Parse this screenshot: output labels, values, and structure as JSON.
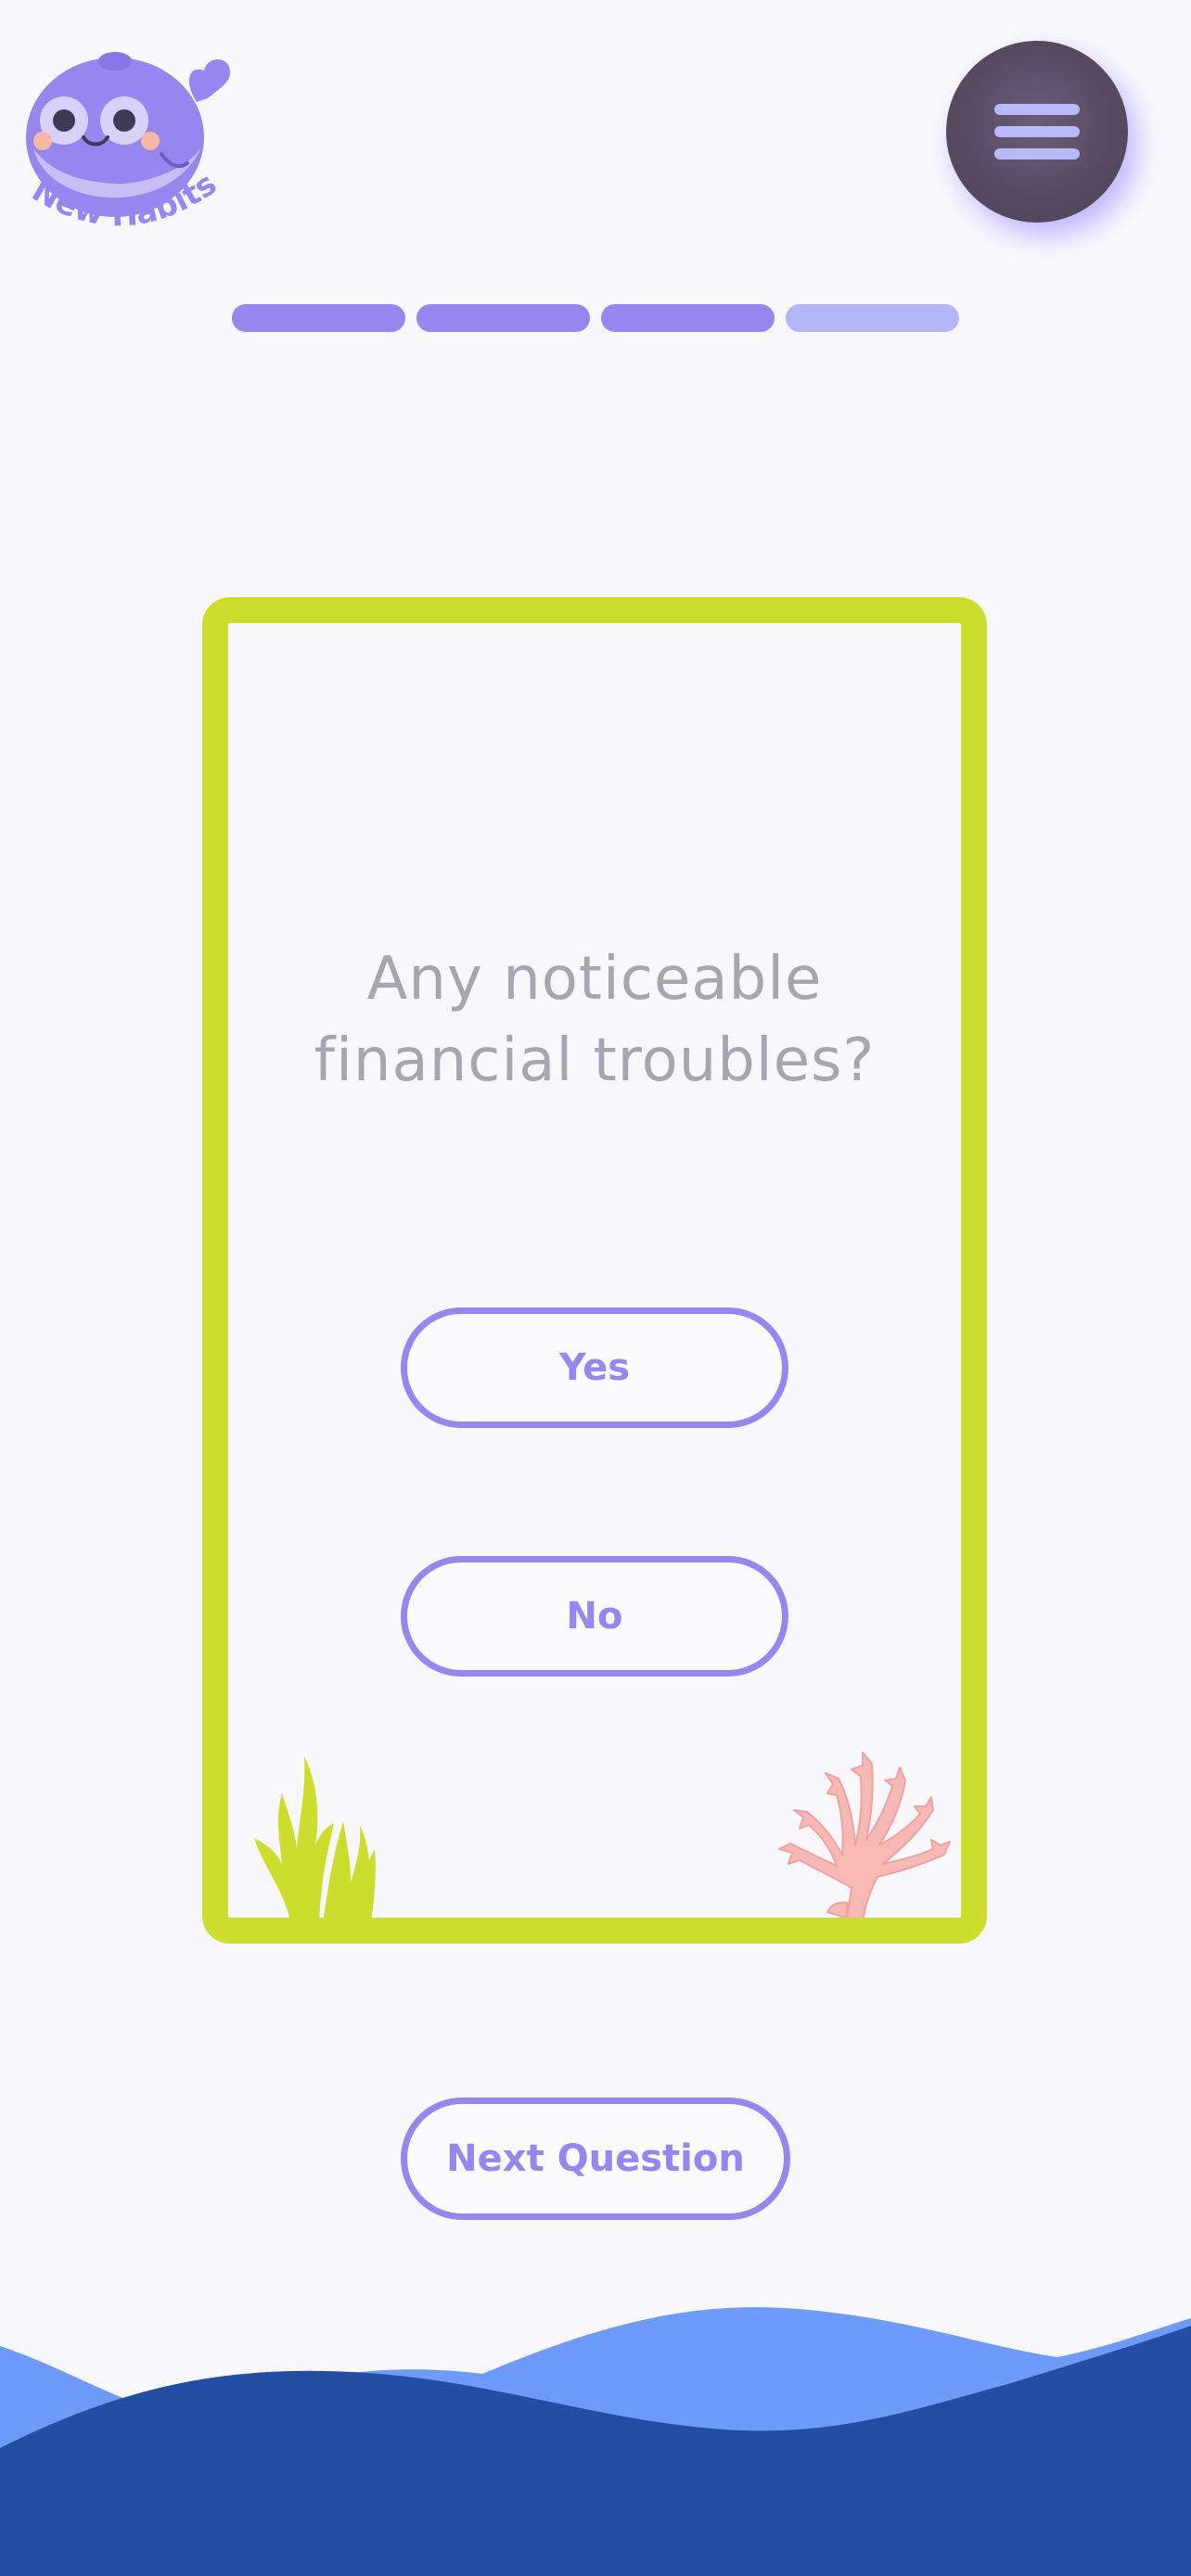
{
  "app": {
    "logo_text": "New Habits",
    "logo_icon": "whale-mascot-icon",
    "menu_icon": "hamburger-menu-icon"
  },
  "progress": {
    "total_steps": 4,
    "completed_steps": 3,
    "active_color": "#9586f0",
    "inactive_color": "#b4b6f7"
  },
  "question": {
    "text_line1": "Any noticeable",
    "text_line2": "financial troubles?"
  },
  "answers": {
    "yes_label": "Yes",
    "no_label": "No"
  },
  "next_label": "Next Question",
  "decor": {
    "left_icon": "seaweed-icon",
    "right_icon": "coral-icon"
  },
  "colors": {
    "accent": "#9586f0",
    "card_border": "#ccdd2e",
    "question_text": "#a8a5b3",
    "wave_light": "#6e9bf9",
    "wave_dark": "#234ea3",
    "coral": "#f6b9b6"
  }
}
